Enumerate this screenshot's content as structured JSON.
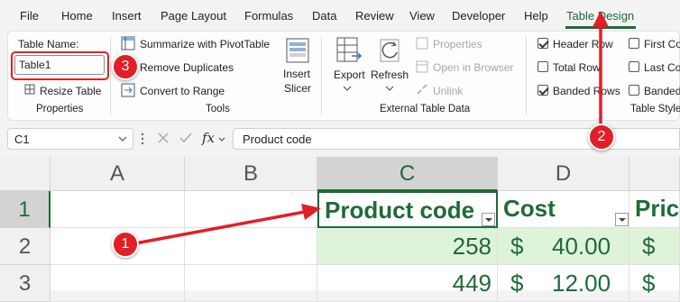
{
  "menu": {
    "tabs": [
      "File",
      "Home",
      "Insert",
      "Page Layout",
      "Formulas",
      "Data",
      "Review",
      "View",
      "Developer",
      "Help",
      "Table Design"
    ]
  },
  "ribbon": {
    "properties": {
      "table_name_label": "Table Name:",
      "table_name_value": "Table1",
      "resize_label": "Resize Table",
      "group_label": "Properties"
    },
    "tools": {
      "summarize_label": "Summarize with PivotTable",
      "remove_dup_label": "Remove Duplicates",
      "convert_label": "Convert to Range",
      "slicer_label_1": "Insert",
      "slicer_label_2": "Slicer",
      "group_label": "Tools"
    },
    "external": {
      "export_label": "Export",
      "refresh_label": "Refresh",
      "properties_label": "Properties",
      "open_browser_label": "Open in Browser",
      "unlink_label": "Unlink",
      "group_label": "External Table Data"
    },
    "style_options": {
      "header_row": "Header Row",
      "total_row": "Total Row",
      "banded_rows": "Banded Rows",
      "first_col": "First Co",
      "last_col": "Last Co",
      "banded_col": "Banded",
      "group_label": "Table Style"
    }
  },
  "formula_bar": {
    "name_box": "C1",
    "fx": "fx",
    "content": "Product code"
  },
  "grid": {
    "columns": [
      "A",
      "B",
      "C",
      "D"
    ],
    "rows": [
      "1",
      "2",
      "3"
    ],
    "header": {
      "c": "Product code",
      "d": "Cost",
      "e": "Pric"
    },
    "row2": {
      "c": "258",
      "d_sym": "$",
      "d": "40.00",
      "e_sym": "$"
    },
    "row3": {
      "c": "449",
      "d_sym": "$",
      "d": "12.00",
      "e_sym": "$"
    }
  },
  "annotations": {
    "badge1": "1",
    "badge2": "2",
    "badge3": "3"
  },
  "colors": {
    "accent": "#1e6b38",
    "annotation": "#e21f26",
    "band": "#dff3d9"
  }
}
